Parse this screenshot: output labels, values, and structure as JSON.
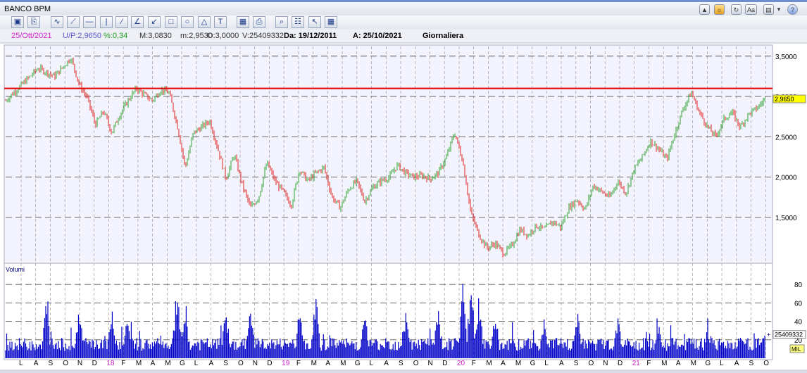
{
  "window": {
    "title": "BANCO BPM"
  },
  "toolbar": {
    "tools": [
      "picture-icon",
      "print-icon",
      "freehand-line-icon",
      "trend-line-icon",
      "horizontal-line-icon",
      "vertical-line-icon",
      "parallel-lines-icon",
      "fan-lines-icon",
      "regression-icon",
      "rectangle-icon",
      "circle-icon",
      "triangle-icon",
      "text-icon",
      "save-icon",
      "print-preview-icon",
      "zoom-icon",
      "calendar-icon",
      "cursor-icon",
      "grid-icon"
    ],
    "right_buttons": [
      "up-button-icon",
      "sun-icon",
      "refresh-icon",
      "font-size-icon",
      "document-icon",
      "menu-arrow-icon",
      "help-icon"
    ],
    "font_label": "Aa"
  },
  "info": {
    "date": "25/Ott/2021",
    "last": "U/P:2,9650",
    "change": "%:0,34",
    "high": "M:3,0830",
    "low": "m:2,9530",
    "open": "O:3,0000",
    "volume": "V:25409332",
    "from": "Da: 19/12/2011",
    "to": "A: 25/10/2021",
    "period": "Giornaliera"
  },
  "colors": {
    "up": "#2ca02c",
    "down": "#e0201c",
    "volume": "#0000c8",
    "resistance": "#e00000",
    "price_tag": "#ffff00",
    "date_magenta": "#d020d0"
  },
  "chart_data": [
    {
      "type": "candlestick",
      "title": "BANCO BPM",
      "ylim": [
        0.95,
        3.62
      ],
      "y_ticks": [
        "1,5000",
        "2,0000",
        "2,5000",
        "3,0000",
        "3,5000"
      ],
      "y_tick_values": [
        1.5,
        2.0,
        2.5,
        3.0,
        3.5
      ],
      "last_price_label": "2,9650",
      "last_price": 2.965,
      "resistance_level": 3.1,
      "grid": true,
      "x_month_labels": [
        "L",
        "A",
        "S",
        "O",
        "N",
        "D",
        "18",
        "F",
        "M",
        "A",
        "M",
        "G",
        "L",
        "A",
        "S",
        "O",
        "N",
        "D",
        "19",
        "F",
        "M",
        "A",
        "M",
        "G",
        "L",
        "A",
        "S",
        "O",
        "N",
        "D",
        "20",
        "F",
        "M",
        "A",
        "M",
        "G",
        "L",
        "A",
        "S",
        "O",
        "N",
        "D",
        "21",
        "F",
        "M",
        "A",
        "M",
        "G",
        "L",
        "A",
        "S",
        "O"
      ],
      "price_path": [
        {
          "t": 0,
          "v": 2.95
        },
        {
          "t": 2,
          "v": 3.15
        },
        {
          "t": 4,
          "v": 3.35
        },
        {
          "t": 6,
          "v": 3.25
        },
        {
          "t": 8,
          "v": 3.48
        },
        {
          "t": 9,
          "v": 3.15
        },
        {
          "t": 10,
          "v": 2.98
        },
        {
          "t": 11,
          "v": 2.65
        },
        {
          "t": 12,
          "v": 2.82
        },
        {
          "t": 13,
          "v": 2.55
        },
        {
          "t": 14,
          "v": 2.78
        },
        {
          "t": 15,
          "v": 2.95
        },
        {
          "t": 16,
          "v": 3.1
        },
        {
          "t": 17,
          "v": 3.02
        },
        {
          "t": 18,
          "v": 2.95
        },
        {
          "t": 19,
          "v": 3.08
        },
        {
          "t": 20,
          "v": 3.05
        },
        {
          "t": 21,
          "v": 2.65
        },
        {
          "t": 22,
          "v": 2.12
        },
        {
          "t": 23,
          "v": 2.55
        },
        {
          "t": 24,
          "v": 2.62
        },
        {
          "t": 25,
          "v": 2.7
        },
        {
          "t": 26,
          "v": 2.35
        },
        {
          "t": 27,
          "v": 1.98
        },
        {
          "t": 28,
          "v": 2.28
        },
        {
          "t": 29,
          "v": 1.9
        },
        {
          "t": 30,
          "v": 1.62
        },
        {
          "t": 31,
          "v": 1.75
        },
        {
          "t": 32,
          "v": 2.18
        },
        {
          "t": 33,
          "v": 1.95
        },
        {
          "t": 34,
          "v": 1.82
        },
        {
          "t": 35,
          "v": 1.65
        },
        {
          "t": 36,
          "v": 2.1
        },
        {
          "t": 37,
          "v": 1.95
        },
        {
          "t": 38,
          "v": 2.05
        },
        {
          "t": 39,
          "v": 2.12
        },
        {
          "t": 40,
          "v": 1.75
        },
        {
          "t": 41,
          "v": 1.62
        },
        {
          "t": 42,
          "v": 1.85
        },
        {
          "t": 43,
          "v": 1.95
        },
        {
          "t": 44,
          "v": 1.7
        },
        {
          "t": 45,
          "v": 1.88
        },
        {
          "t": 46,
          "v": 1.95
        },
        {
          "t": 47,
          "v": 2.0
        },
        {
          "t": 48,
          "v": 2.15
        },
        {
          "t": 49,
          "v": 2.05
        },
        {
          "t": 50,
          "v": 2.0
        },
        {
          "t": 51,
          "v": 2.02
        },
        {
          "t": 52,
          "v": 1.98
        },
        {
          "t": 53,
          "v": 2.05
        },
        {
          "t": 54,
          "v": 2.25
        },
        {
          "t": 55,
          "v": 2.55
        },
        {
          "t": 56,
          "v": 2.2
        },
        {
          "t": 57,
          "v": 1.55
        },
        {
          "t": 58,
          "v": 1.28
        },
        {
          "t": 59,
          "v": 1.12
        },
        {
          "t": 60,
          "v": 1.18
        },
        {
          "t": 61,
          "v": 1.05
        },
        {
          "t": 62,
          "v": 1.15
        },
        {
          "t": 63,
          "v": 1.35
        },
        {
          "t": 64,
          "v": 1.28
        },
        {
          "t": 65,
          "v": 1.4
        },
        {
          "t": 66,
          "v": 1.35
        },
        {
          "t": 67,
          "v": 1.45
        },
        {
          "t": 68,
          "v": 1.38
        },
        {
          "t": 69,
          "v": 1.62
        },
        {
          "t": 70,
          "v": 1.72
        },
        {
          "t": 71,
          "v": 1.6
        },
        {
          "t": 72,
          "v": 1.9
        },
        {
          "t": 73,
          "v": 1.82
        },
        {
          "t": 74,
          "v": 1.75
        },
        {
          "t": 75,
          "v": 1.95
        },
        {
          "t": 76,
          "v": 1.8
        },
        {
          "t": 77,
          "v": 2.1
        },
        {
          "t": 78,
          "v": 2.25
        },
        {
          "t": 79,
          "v": 2.45
        },
        {
          "t": 80,
          "v": 2.35
        },
        {
          "t": 81,
          "v": 2.22
        },
        {
          "t": 82,
          "v": 2.55
        },
        {
          "t": 83,
          "v": 2.85
        },
        {
          "t": 84,
          "v": 3.05
        },
        {
          "t": 85,
          "v": 2.8
        },
        {
          "t": 86,
          "v": 2.62
        },
        {
          "t": 87,
          "v": 2.5
        },
        {
          "t": 88,
          "v": 2.72
        },
        {
          "t": 89,
          "v": 2.8
        },
        {
          "t": 90,
          "v": 2.62
        },
        {
          "t": 91,
          "v": 2.78
        },
        {
          "t": 92,
          "v": 2.85
        },
        {
          "t": 93,
          "v": 2.965
        }
      ]
    },
    {
      "type": "bar",
      "title": "Volumi",
      "ylim": [
        0,
        100
      ],
      "y_ticks": [
        "20",
        "40",
        "60",
        "80"
      ],
      "y_tick_values": [
        20,
        40,
        60,
        80
      ],
      "unit_label": "MIL",
      "last_volume_label": "25409332",
      "last_volume": 25.4,
      "volume_peaks": [
        {
          "t": 5,
          "v": 70
        },
        {
          "t": 9,
          "v": 72
        },
        {
          "t": 13,
          "v": 62
        },
        {
          "t": 15,
          "v": 58
        },
        {
          "t": 21,
          "v": 88
        },
        {
          "t": 22,
          "v": 68
        },
        {
          "t": 27,
          "v": 60
        },
        {
          "t": 30,
          "v": 65
        },
        {
          "t": 36,
          "v": 58
        },
        {
          "t": 38,
          "v": 72
        },
        {
          "t": 44,
          "v": 55
        },
        {
          "t": 49,
          "v": 60
        },
        {
          "t": 53,
          "v": 62
        },
        {
          "t": 56,
          "v": 80
        },
        {
          "t": 57,
          "v": 92
        },
        {
          "t": 58,
          "v": 75
        },
        {
          "t": 60,
          "v": 55
        },
        {
          "t": 66,
          "v": 48
        },
        {
          "t": 70,
          "v": 62
        },
        {
          "t": 75,
          "v": 50
        },
        {
          "t": 80,
          "v": 40
        },
        {
          "t": 86,
          "v": 45
        },
        {
          "t": 90,
          "v": 40
        },
        {
          "t": 93,
          "v": 30
        }
      ]
    }
  ]
}
